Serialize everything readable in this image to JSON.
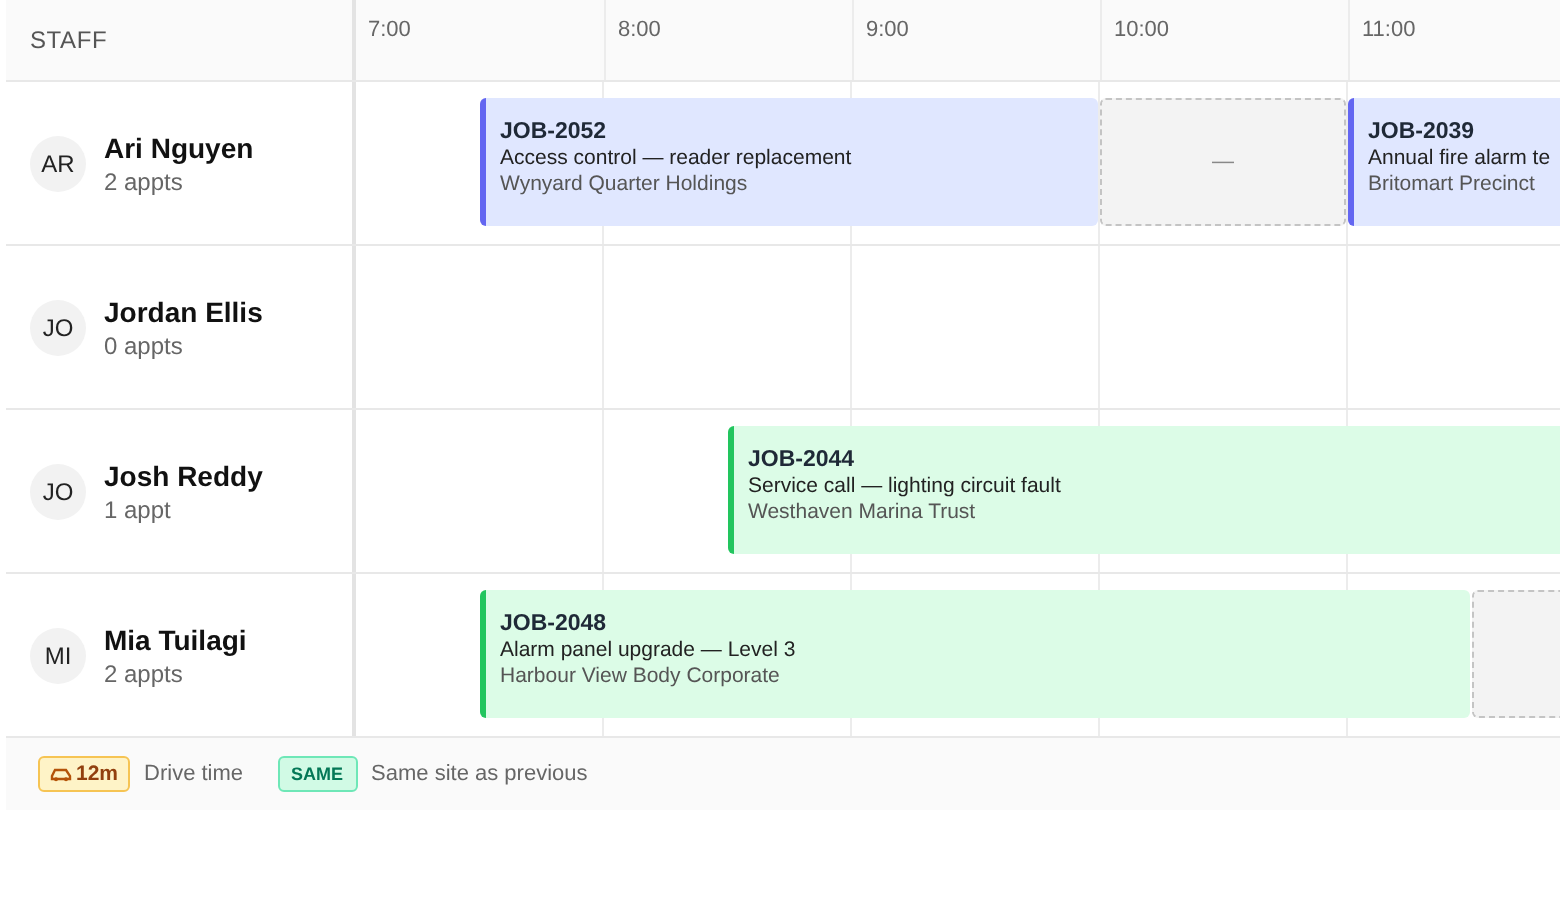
{
  "header": {
    "staff_label": "STAFF",
    "hours": [
      "7:00",
      "8:00",
      "9:00",
      "10:00",
      "11:00"
    ]
  },
  "rows": [
    {
      "initials": "AR",
      "name": "Ari Nguyen",
      "count": "2 appts",
      "items": [
        {
          "kind": "job",
          "id": "JOB-2052",
          "title": "Access control — reader replacement",
          "client": "Wynyard Quarter Holdings",
          "color": "#6366f1"
        },
        {
          "kind": "gap",
          "label": "—"
        },
        {
          "kind": "job",
          "id": "JOB-2039",
          "title": "Annual fire alarm te",
          "client": "Britomart Precinct",
          "color": "#6366f1"
        }
      ]
    },
    {
      "initials": "JO",
      "name": "Jordan Ellis",
      "count": "0 appts",
      "items": []
    },
    {
      "initials": "JO",
      "name": "Josh Reddy",
      "count": "1 appt",
      "items": [
        {
          "kind": "job",
          "id": "JOB-2044",
          "title": "Service call — lighting circuit fault",
          "client": "Westhaven Marina Trust",
          "color": "#22c55e"
        }
      ]
    },
    {
      "initials": "MI",
      "name": "Mia Tuilagi",
      "count": "2 appts",
      "items": [
        {
          "kind": "job",
          "id": "JOB-2048",
          "title": "Alarm panel upgrade — Level 3",
          "client": "Harbour View Body Corporate",
          "color": "#22c55e"
        },
        {
          "kind": "gap"
        }
      ]
    }
  ],
  "legend": {
    "drive_badge": "12m",
    "drive_label": "Drive time",
    "same_badge": "SAME",
    "same_label": "Same site as previous"
  }
}
